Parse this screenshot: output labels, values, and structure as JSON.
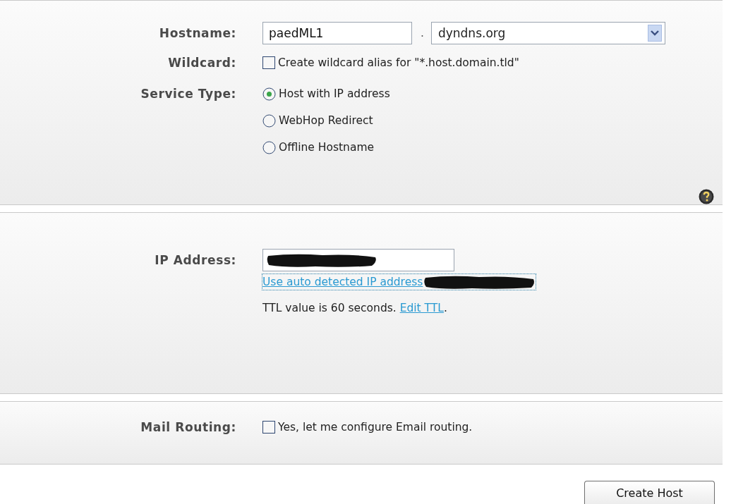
{
  "hostname": {
    "label": "Hostname:",
    "value": "paedML1",
    "separator": ".",
    "domain": "dyndns.org"
  },
  "wildcard": {
    "label": "Wildcard:",
    "checked": false,
    "text": "Create wildcard alias for \"*.host.domain.tld\""
  },
  "service_type": {
    "label": "Service Type:",
    "options": [
      {
        "label": "Host with IP address",
        "selected": true
      },
      {
        "label": "WebHop Redirect",
        "selected": false
      },
      {
        "label": "Offline Hostname",
        "selected": false
      }
    ]
  },
  "ip_address": {
    "label": "IP Address:",
    "auto_detect_link": "Use auto detected IP address",
    "ttl_text": "TTL value is 60 seconds. ",
    "ttl_link": "Edit TTL",
    "ttl_end": "."
  },
  "mail_routing": {
    "label": "Mail Routing:",
    "checked": false,
    "text": "Yes, let me configure Email routing."
  },
  "button": "Create Host"
}
